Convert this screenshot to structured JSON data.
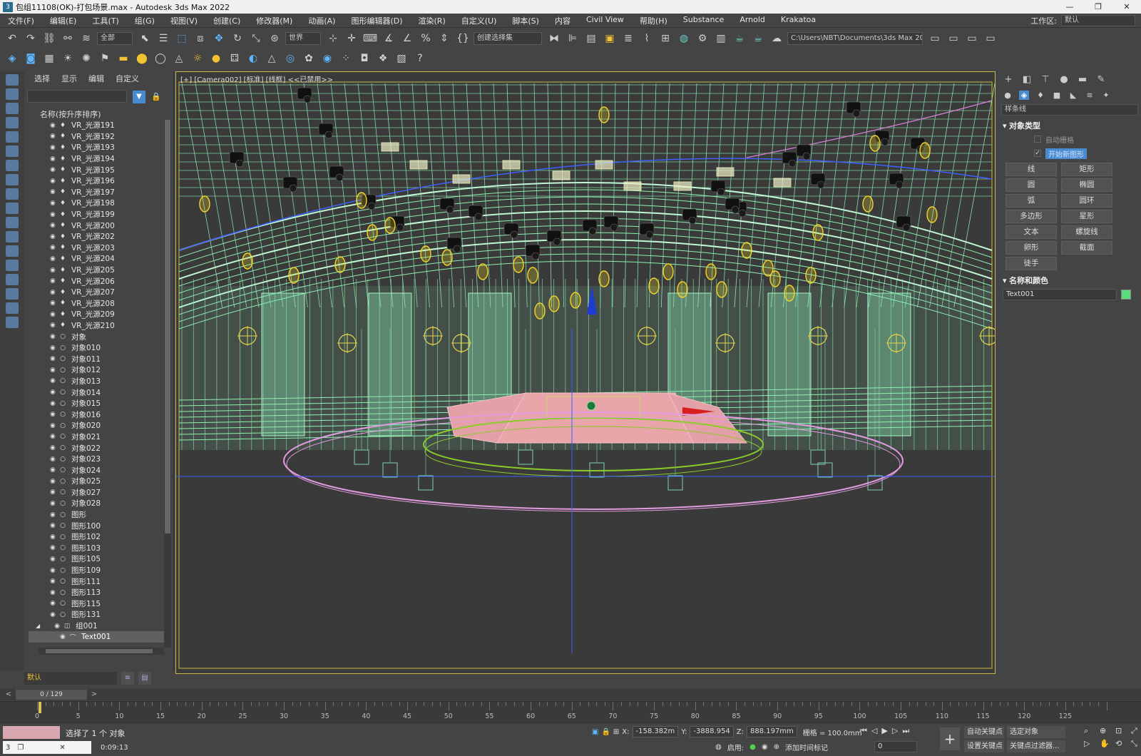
{
  "window": {
    "title": "包组11108(OK)-打包场景.max - Autodesk 3ds Max 2022",
    "app_icon": "3",
    "minimize": "—",
    "restore": "❐",
    "close": "✕"
  },
  "menubar": {
    "items": [
      "文件(F)",
      "编辑(E)",
      "工具(T)",
      "组(G)",
      "视图(V)",
      "创建(C)",
      "修改器(M)",
      "动画(A)",
      "图形编辑器(D)",
      "渲染(R)",
      "自定义(U)",
      "脚本(S)",
      "内容",
      "Civil View",
      "帮助(H)",
      "Substance",
      "Arnold",
      "Krakatoa"
    ],
    "workspace_label": "工作区:",
    "workspace_value": "默认"
  },
  "toolbar1": {
    "selection_filter": "全部",
    "ref_coord": "世界",
    "named_selection": "创建选择集",
    "project_path": "C:\\Users\\NBT\\Documents\\3ds Max 2022"
  },
  "explorer": {
    "tabs": [
      "选择",
      "显示",
      "编辑",
      "自定义"
    ],
    "search_clear": "✕",
    "filter_icon": "▼",
    "lock_icon": "🔒",
    "column_header": "名称(按升序排序)",
    "rows": [
      {
        "label": "VR_光源191",
        "icon": "light"
      },
      {
        "label": "VR_光源192",
        "icon": "light"
      },
      {
        "label": "VR_光源193",
        "icon": "light"
      },
      {
        "label": "VR_光源194",
        "icon": "light"
      },
      {
        "label": "VR_光源195",
        "icon": "light"
      },
      {
        "label": "VR_光源196",
        "icon": "light"
      },
      {
        "label": "VR_光源197",
        "icon": "light"
      },
      {
        "label": "VR_光源198",
        "icon": "light"
      },
      {
        "label": "VR_光源199",
        "icon": "light"
      },
      {
        "label": "VR_光源200",
        "icon": "light"
      },
      {
        "label": "VR_光源202",
        "icon": "light"
      },
      {
        "label": "VR_光源203",
        "icon": "light"
      },
      {
        "label": "VR_光源204",
        "icon": "light"
      },
      {
        "label": "VR_光源205",
        "icon": "light"
      },
      {
        "label": "VR_光源206",
        "icon": "light"
      },
      {
        "label": "VR_光源207",
        "icon": "light"
      },
      {
        "label": "VR_光源208",
        "icon": "light"
      },
      {
        "label": "VR_光源209",
        "icon": "light"
      },
      {
        "label": "VR_光源210",
        "icon": "light"
      },
      {
        "label": "对象",
        "icon": "object"
      },
      {
        "label": "对象010",
        "icon": "object"
      },
      {
        "label": "对象011",
        "icon": "object"
      },
      {
        "label": "对象012",
        "icon": "object"
      },
      {
        "label": "对象013",
        "icon": "object"
      },
      {
        "label": "对象014",
        "icon": "object"
      },
      {
        "label": "对象015",
        "icon": "object"
      },
      {
        "label": "对象016",
        "icon": "object"
      },
      {
        "label": "对象020",
        "icon": "object"
      },
      {
        "label": "对象021",
        "icon": "object"
      },
      {
        "label": "对象022",
        "icon": "object"
      },
      {
        "label": "对象023",
        "icon": "object"
      },
      {
        "label": "对象024",
        "icon": "object"
      },
      {
        "label": "对象025",
        "icon": "object"
      },
      {
        "label": "对象027",
        "icon": "object"
      },
      {
        "label": "对象028",
        "icon": "object"
      },
      {
        "label": "图形",
        "icon": "object"
      },
      {
        "label": "图形100",
        "icon": "object"
      },
      {
        "label": "图形102",
        "icon": "object"
      },
      {
        "label": "图形103",
        "icon": "object"
      },
      {
        "label": "图形105",
        "icon": "object"
      },
      {
        "label": "图形109",
        "icon": "object"
      },
      {
        "label": "图形111",
        "icon": "object"
      },
      {
        "label": "图形113",
        "icon": "object"
      },
      {
        "label": "图形115",
        "icon": "object"
      },
      {
        "label": "图形131",
        "icon": "object"
      },
      {
        "label": "组001",
        "icon": "group",
        "kind": "group"
      },
      {
        "label": "Text001",
        "icon": "shape",
        "kind": "child",
        "selected": true
      }
    ],
    "layer": "默认"
  },
  "viewport": {
    "label": "[+] [Camera002] [标准] [线框] <<已禁用>>"
  },
  "cmdpanel": {
    "category": "样条线",
    "rollout_object_type": "对象类型",
    "autogrid": "自动栅格",
    "start_new_shape": "开始新图形",
    "start_new_checked": "✓",
    "buttons": [
      "线",
      "矩形",
      "圆",
      "椭圆",
      "弧",
      "圆环",
      "多边形",
      "星形",
      "文本",
      "螺旋线",
      "卵形",
      "截面",
      "徒手"
    ],
    "rollout_name_color": "名称和颜色",
    "object_name": "Text001",
    "object_color": "#5adc7a"
  },
  "timeslider": {
    "frame": "0 / 129",
    "prev": "<",
    "next": ">"
  },
  "trackbar": {
    "labels": [
      "0",
      "5",
      "10",
      "15",
      "20",
      "25",
      "30",
      "35",
      "40",
      "45",
      "50",
      "55",
      "60",
      "65",
      "70",
      "75",
      "80",
      "85",
      "90",
      "95",
      "100",
      "105",
      "110",
      "115",
      "120",
      "125"
    ]
  },
  "statusbar": {
    "selection_text": "选择了 1 个 对象",
    "time": "0:09:13",
    "x_label": "X:",
    "x": "-158.382m",
    "y_label": "Y:",
    "y": "-3888.954",
    "z_label": "Z:",
    "z": "888.197mm",
    "grid": "栅格 = 100.0mm",
    "enable_label": "启用:",
    "add_time_tag": "添加时间标记",
    "frame_field": "0",
    "auto_key": "自动关键点",
    "selected_object": "选定对象",
    "set_key": "设置关键点",
    "key_filters": "关键点过滤器..."
  }
}
